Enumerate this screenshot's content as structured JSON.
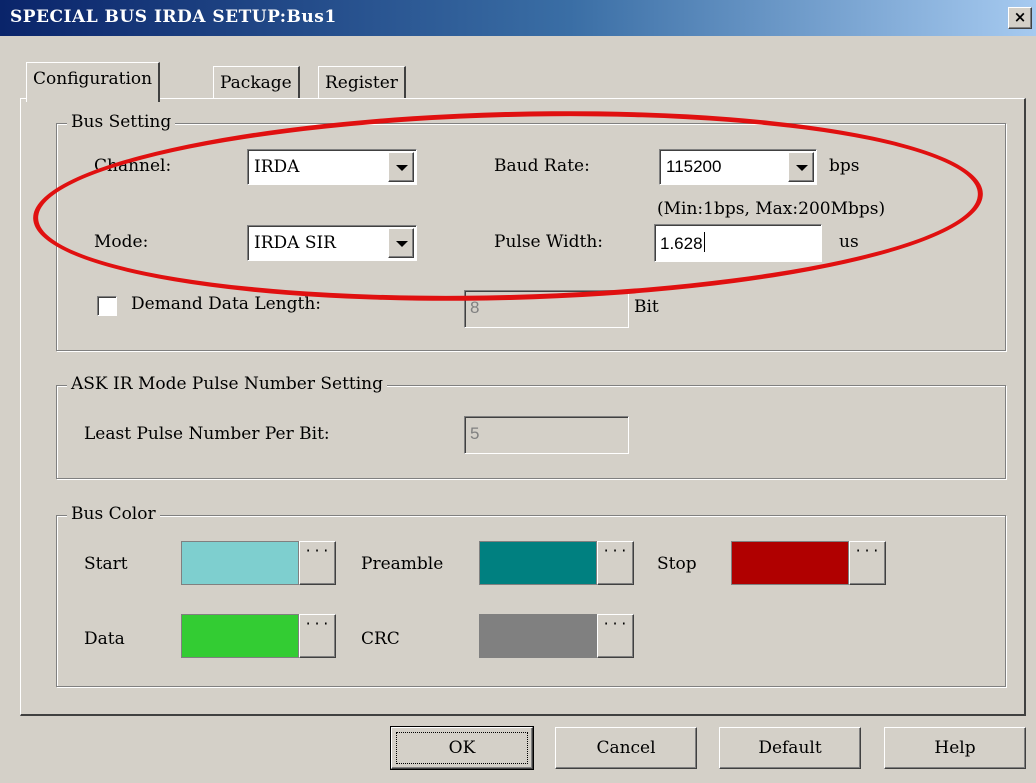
{
  "window": {
    "title": "SPECIAL BUS IRDA SETUP:Bus1",
    "close_glyph": "×"
  },
  "tabs": [
    {
      "label": "Configuration",
      "active": true
    },
    {
      "label": "Package",
      "active": false
    },
    {
      "label": "Register",
      "active": false
    }
  ],
  "bus_setting": {
    "group_label": "Bus Setting",
    "channel_label": "Channel:",
    "channel_value": "IRDA",
    "mode_label": "Mode:",
    "mode_value": "IRDA SIR",
    "baud_rate_label": "Baud Rate:",
    "baud_rate_value": "115200",
    "baud_rate_unit": "bps",
    "baud_rate_range": "(Min:1bps, Max:200Mbps)",
    "pulse_width_label": "Pulse Width:",
    "pulse_width_value": "1.628",
    "pulse_width_unit": "us",
    "demand_label": "Demand Data Length:",
    "demand_checked": false,
    "demand_value": "8",
    "demand_unit": "Bit"
  },
  "ask_ir": {
    "group_label": "ASK IR Mode Pulse Number Setting",
    "least_pulse_label": "Least Pulse Number Per Bit:",
    "least_pulse_value": "5"
  },
  "bus_color": {
    "group_label": "Bus Color",
    "picker_glyph": "···",
    "items": [
      {
        "label": "Start",
        "color": "#7ecfcf"
      },
      {
        "label": "Preamble",
        "color": "#008080"
      },
      {
        "label": "Stop",
        "color": "#b00000"
      },
      {
        "label": "Data",
        "color": "#33cc33"
      },
      {
        "label": "CRC",
        "color": "#808080"
      }
    ]
  },
  "buttons": {
    "ok": "OK",
    "cancel": "Cancel",
    "default": "Default",
    "help": "Help"
  },
  "annotation": {
    "color": "#e01010",
    "shape": "ellipse"
  }
}
